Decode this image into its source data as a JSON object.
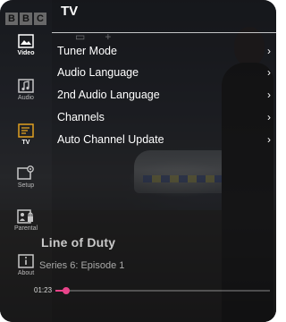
{
  "header": {
    "title": "TV"
  },
  "badge": [
    "B",
    "B",
    "C"
  ],
  "sidebar": {
    "items": [
      {
        "label": "Video",
        "icon": "video-icon",
        "active": true
      },
      {
        "label": "Audio",
        "icon": "music-note-icon",
        "active": false
      },
      {
        "label": "TV",
        "icon": "tv-guide-icon",
        "active": true
      },
      {
        "label": "Setup",
        "icon": "setup-gear-icon",
        "active": false
      },
      {
        "label": "Parental",
        "icon": "parental-lock-icon",
        "active": false
      },
      {
        "label": "About",
        "icon": "info-icon",
        "active": false
      }
    ]
  },
  "menu": {
    "items": [
      {
        "label": "Tuner Mode",
        "chevron": "›"
      },
      {
        "label": "Audio Language",
        "chevron": "›"
      },
      {
        "label": "2nd Audio Language",
        "chevron": "›"
      },
      {
        "label": "Channels",
        "chevron": "›"
      },
      {
        "label": "Auto Channel Update",
        "chevron": "›"
      }
    ]
  },
  "player": {
    "title": "Line of Duty",
    "subtitle": "Series 6: Episode 1",
    "time": "01:23",
    "progress": 0.05
  },
  "colors": {
    "accent": "#e8448a",
    "tv_icon": "#e0a020"
  }
}
